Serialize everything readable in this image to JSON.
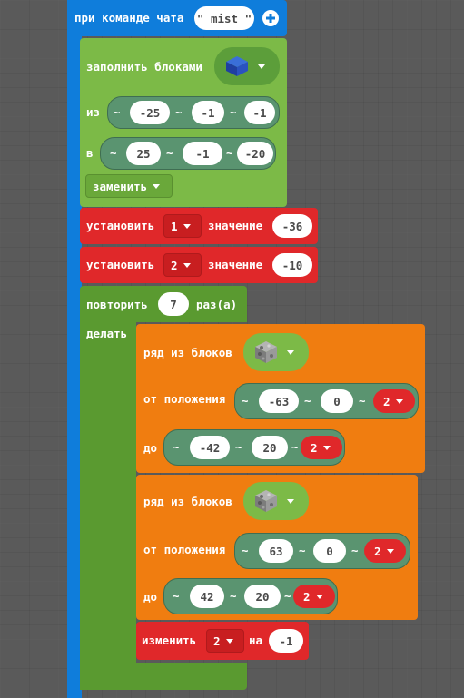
{
  "event": {
    "label": "при команде чата",
    "command": "mist"
  },
  "fill": {
    "label": "заполнить блоками",
    "from_label": "из",
    "from": [
      "-25",
      "-1",
      "-1"
    ],
    "to_label": "в",
    "to": [
      "25",
      "-1",
      "-20"
    ],
    "mode": "заменить",
    "tilde": "~"
  },
  "set1": {
    "label": "установить",
    "var": "1",
    "value_label": "значение",
    "value": "-36"
  },
  "set2": {
    "label": "установить",
    "var": "2",
    "value_label": "значение",
    "value": "-10"
  },
  "repeat": {
    "label": "повторить",
    "count": "7",
    "suffix": "раз(а)",
    "do_label": "делать"
  },
  "line1": {
    "label": "ряд из блоков",
    "from_label": "от положения",
    "from": [
      "-63",
      "0",
      "2"
    ],
    "to_label": "до",
    "to": [
      "-42",
      "20",
      "2"
    ]
  },
  "line2": {
    "label": "ряд из блоков",
    "from_label": "от положения",
    "from": [
      "63",
      "0",
      "2"
    ],
    "to_label": "до",
    "to": [
      "42",
      "20",
      "2"
    ]
  },
  "change": {
    "label": "изменить",
    "var": "2",
    "by_label": "на",
    "value": "-1"
  },
  "colors": {
    "event": "#0f7ddb",
    "blocks": "#7cba47",
    "variables": "#e0282a",
    "loops": "#5a9a30",
    "shapes": "#f07d10"
  },
  "icons": {
    "add": "plus-circle-icon",
    "block_blue": "blue-cube-icon",
    "block_stone": "cobblestone-block-icon"
  }
}
